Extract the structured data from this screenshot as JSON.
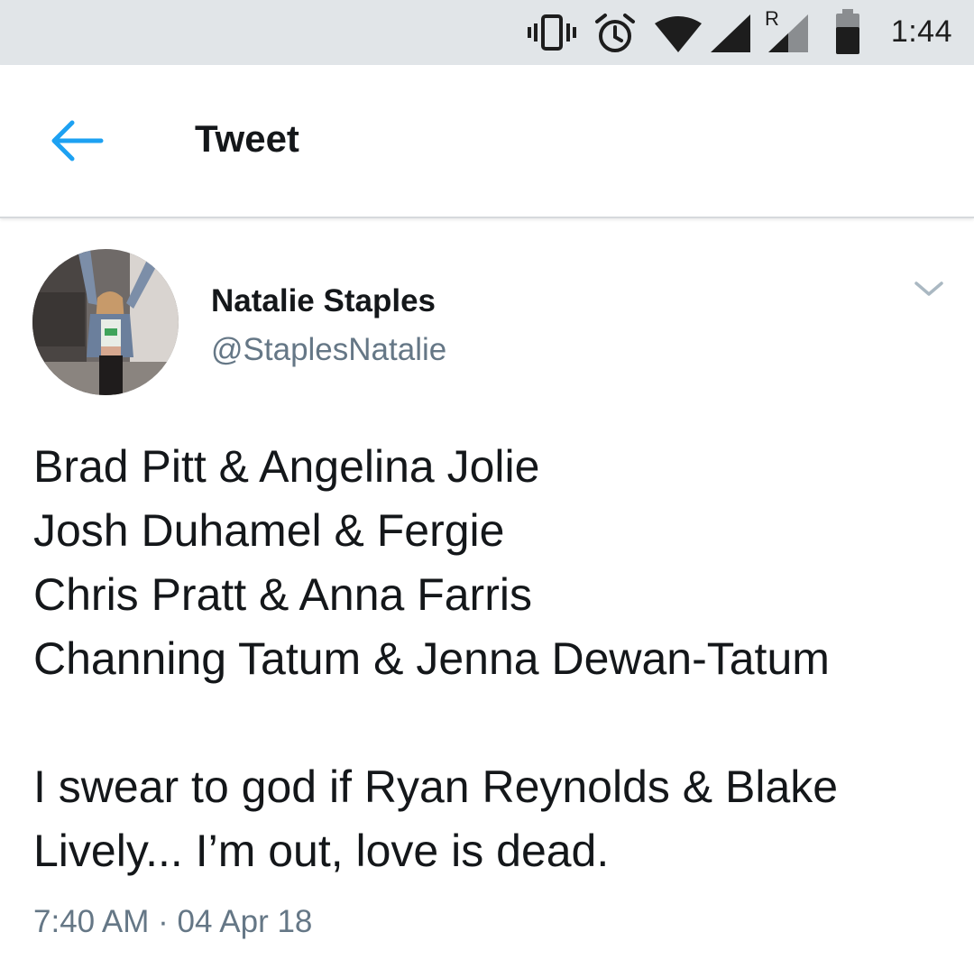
{
  "status_bar": {
    "time": "1:44",
    "roaming_label": "R",
    "icons": [
      "vibrate-icon",
      "alarm-icon",
      "wifi-icon",
      "cell-signal-icon",
      "roaming-signal-icon",
      "battery-icon"
    ]
  },
  "app_bar": {
    "back_icon": "arrow-left-icon",
    "title": "Tweet",
    "accent_color": "#1da1f2"
  },
  "tweet": {
    "author": {
      "name": "Natalie Staples",
      "handle": "@StaplesNatalie"
    },
    "menu_icon": "chevron-down-icon",
    "text_lines": [
      "Brad Pitt & Angelina Jolie",
      "Josh Duhamel & Fergie",
      "Chris Pratt & Anna Farris",
      "Channing Tatum & Jenna Dewan-Tatum",
      "",
      "I swear to god if Ryan Reynolds & Blake",
      "Lively... I’m out, love is dead."
    ],
    "time": "7:40 AM",
    "separator": "·",
    "date": "04 Apr 18"
  }
}
